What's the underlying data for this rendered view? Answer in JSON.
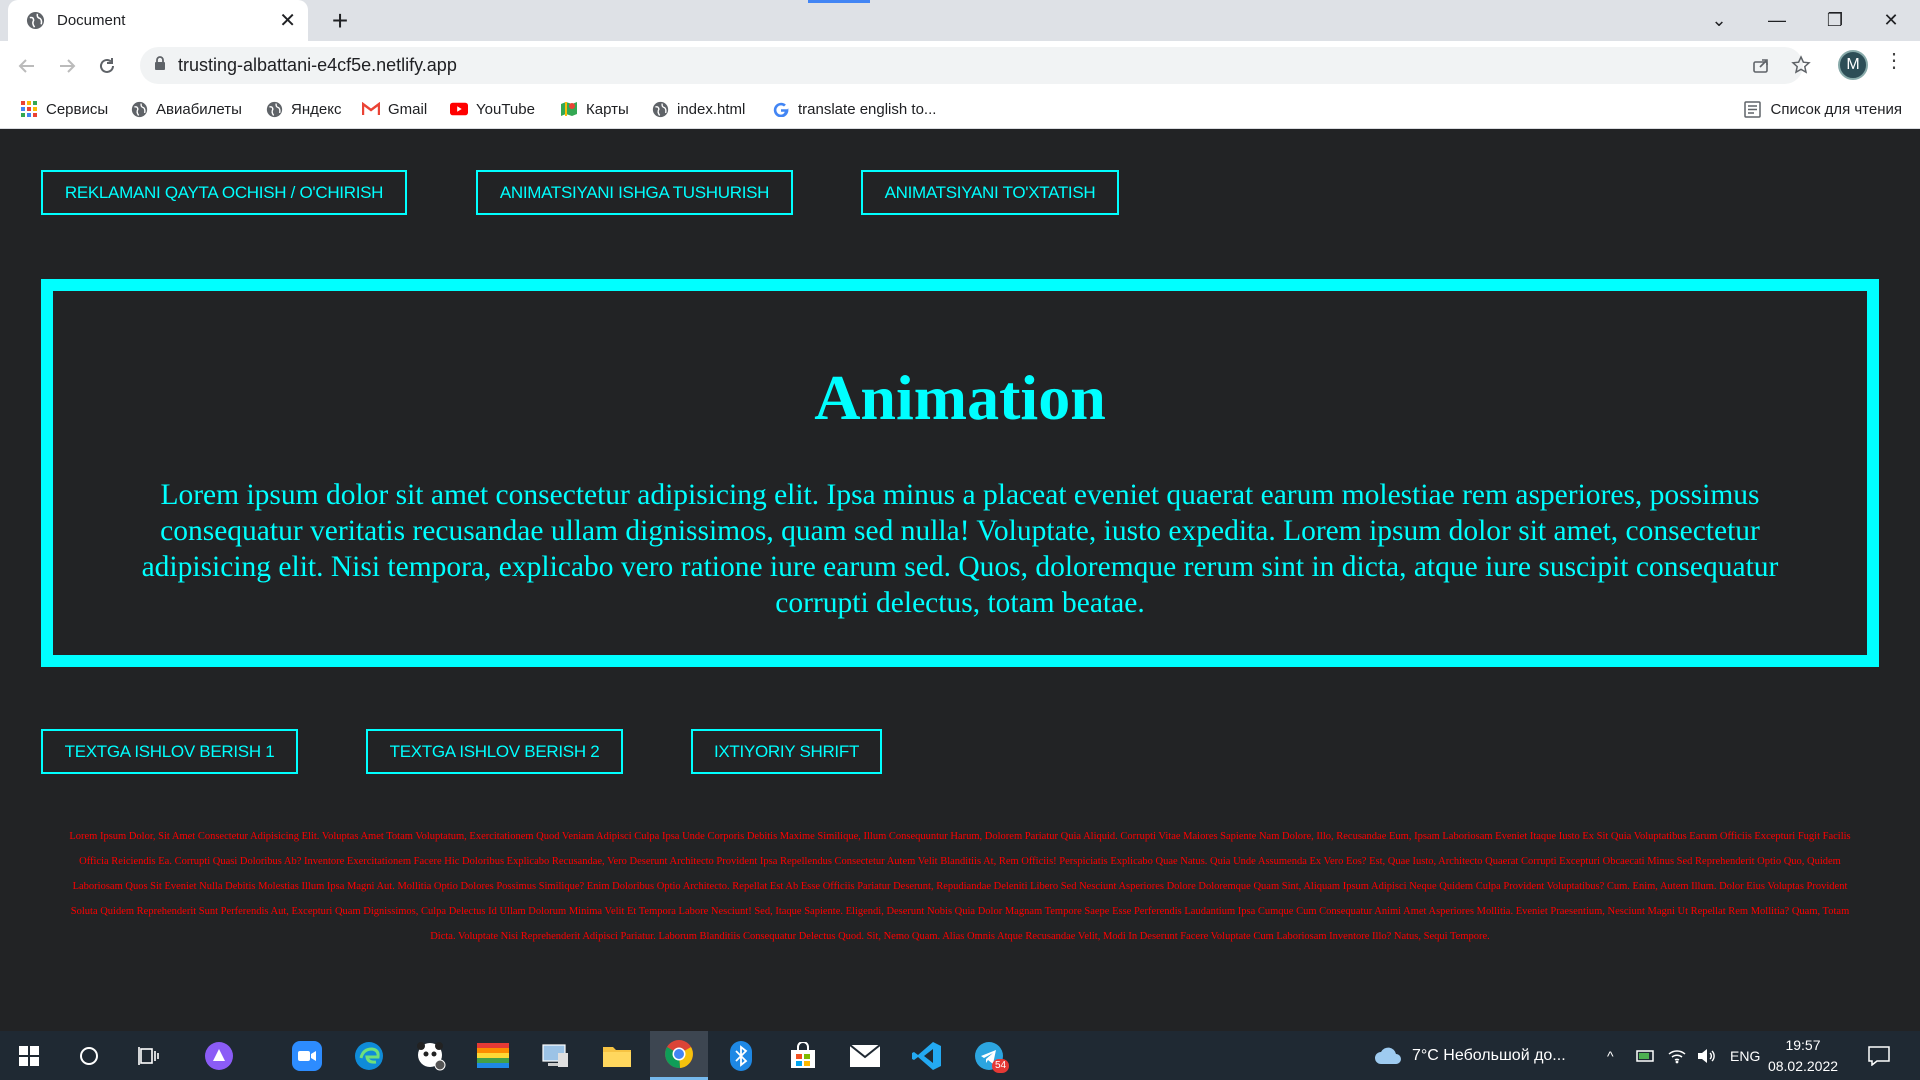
{
  "browser": {
    "tab_title": "Document",
    "tab_close": "✕",
    "new_tab": "+",
    "url": "trusting-albattani-e4cf5e.netlify.app",
    "avatar_letter": "M",
    "menu": "⋮",
    "window_controls": {
      "chevron": "⌄",
      "minimize": "—",
      "restore": "❐",
      "close": "✕"
    },
    "bookmarks": [
      {
        "label": "Сервисы",
        "icon": "apps-grid-icon"
      },
      {
        "label": "Авиабилеты",
        "icon": "globe-icon"
      },
      {
        "label": "Яндекс",
        "icon": "globe-icon"
      },
      {
        "label": "Gmail",
        "icon": "gmail-icon"
      },
      {
        "label": "YouTube",
        "icon": "youtube-icon"
      },
      {
        "label": "Карты",
        "icon": "maps-icon"
      },
      {
        "label": "index.html",
        "icon": "globe-icon"
      },
      {
        "label": "translate english to...",
        "icon": "google-icon"
      }
    ],
    "reading_list": "Список для чтения"
  },
  "page": {
    "top_buttons": [
      "REKLAMANI QAYTA OCHISH / O'CHIRISH",
      "ANIMATSIYANI ISHGA TUSHURISH",
      "ANIMATSIYANI TO'XTATISH"
    ],
    "animation": {
      "title": "Animation",
      "text": "Lorem ipsum dolor sit amet consectetur adipisicing elit. Ipsa minus a placeat eveniet quaerat earum molestiae rem asperiores, possimus consequatur veritatis recusandae ullam dignissimos, quam sed nulla! Voluptate, iusto expedita. Lorem ipsum dolor sit amet, consectetur adipisicing elit. Nisi tempora, explicabo vero ratione iure earum sed. Quos, doloremque rerum sint in dicta, atque iure suscipit consequatur corrupti delectus, totam beatae."
    },
    "bottom_buttons": [
      "TEXTGA ISHLOV BERISH 1",
      "TEXTGA ISHLOV BERISH 2",
      "IXTIYORIY SHRIFT"
    ],
    "red_text": "Lorem Ipsum Dolor, Sit Amet Consectetur Adipisicing Elit. Voluptas Amet Totam Voluptatum, Exercitationem Quod Veniam Adipisci Culpa Ipsa Unde Corporis Debitis Maxime Similique, Illum Consequuntur Harum, Dolorem Pariatur Quia Aliquid. Corrupti Vitae Maiores Sapiente Nam Dolore, Illo, Recusandae Eum, Ipsam Laboriosam Eveniet Itaque Iusto Ex Sit Quia Voluptatibus Earum Officiis Excepturi Fugit Facilis Officia Reiciendis Ea. Corrupti Quasi Doloribus Ab? Inventore Exercitationem Facere Hic Doloribus Explicabo Recusandae, Vero Deserunt Architecto Provident Ipsa Repellendus Consectetur Autem Velit Blanditiis At, Rem Officiis! Perspiciatis Explicabo Quae Natus. Quia Unde Assumenda Ex Vero Eos? Est, Quae Iusto, Architecto Quaerat Corrupti Excepturi Obcaecati Minus Sed Reprehenderit Optio Quo, Quidem Laboriosam Quos Sit Eveniet Nulla Debitis Molestias Illum Ipsa Magni Aut. Mollitia Optio Dolores Possimus Similique? Enim Doloribus Optio Architecto. Repellat Est Ab Esse Officiis Pariatur Deserunt, Repudiandae Deleniti Libero Sed Nesciunt Asperiores Dolore Doloremque Quam Sint, Aliquam Ipsum Adipisci Neque Quidem Culpa Provident Voluptatibus? Cum. Enim, Autem Illum. Dolor Eius Voluptas Provident Soluta Quidem Reprehenderit Sunt Perferendis Aut, Excepturi Quam Dignissimos, Culpa Delectus Id Ullam Dolorum Minima Velit Et Tempora Labore Nesciunt! Sed, Itaque Sapiente. Eligendi, Deserunt Nobis Quia Dolor Magnam Tempore Saepe Esse Perferendis Laudantium Ipsa Cumque Cum Consequatur Animi Amet Asperiores Mollitia. Eveniet Praesentium, Nesciunt Magni Ut Repellat Rem Mollitia? Quam, Totam Dicta. Voluptate Nisi Reprehenderit Adipisci Pariatur. Laborum Blanditiis Consequatur Delectus Quod. Sit, Nemo Quam. Alias Omnis Atque Recusandae Velit, Modi In Deserunt Facere Voluptate Cum Laboriosam Inventore Illo? Natus, Sequi Tempore."
  },
  "taskbar": {
    "weather": "7°C  Небольшой до...",
    "language": "ENG",
    "time": "19:57",
    "date": "08.02.2022",
    "telegram_badge": "54"
  },
  "colors": {
    "accent": "#00ffff",
    "page_bg": "#222325",
    "red_text": "#ff0000"
  }
}
